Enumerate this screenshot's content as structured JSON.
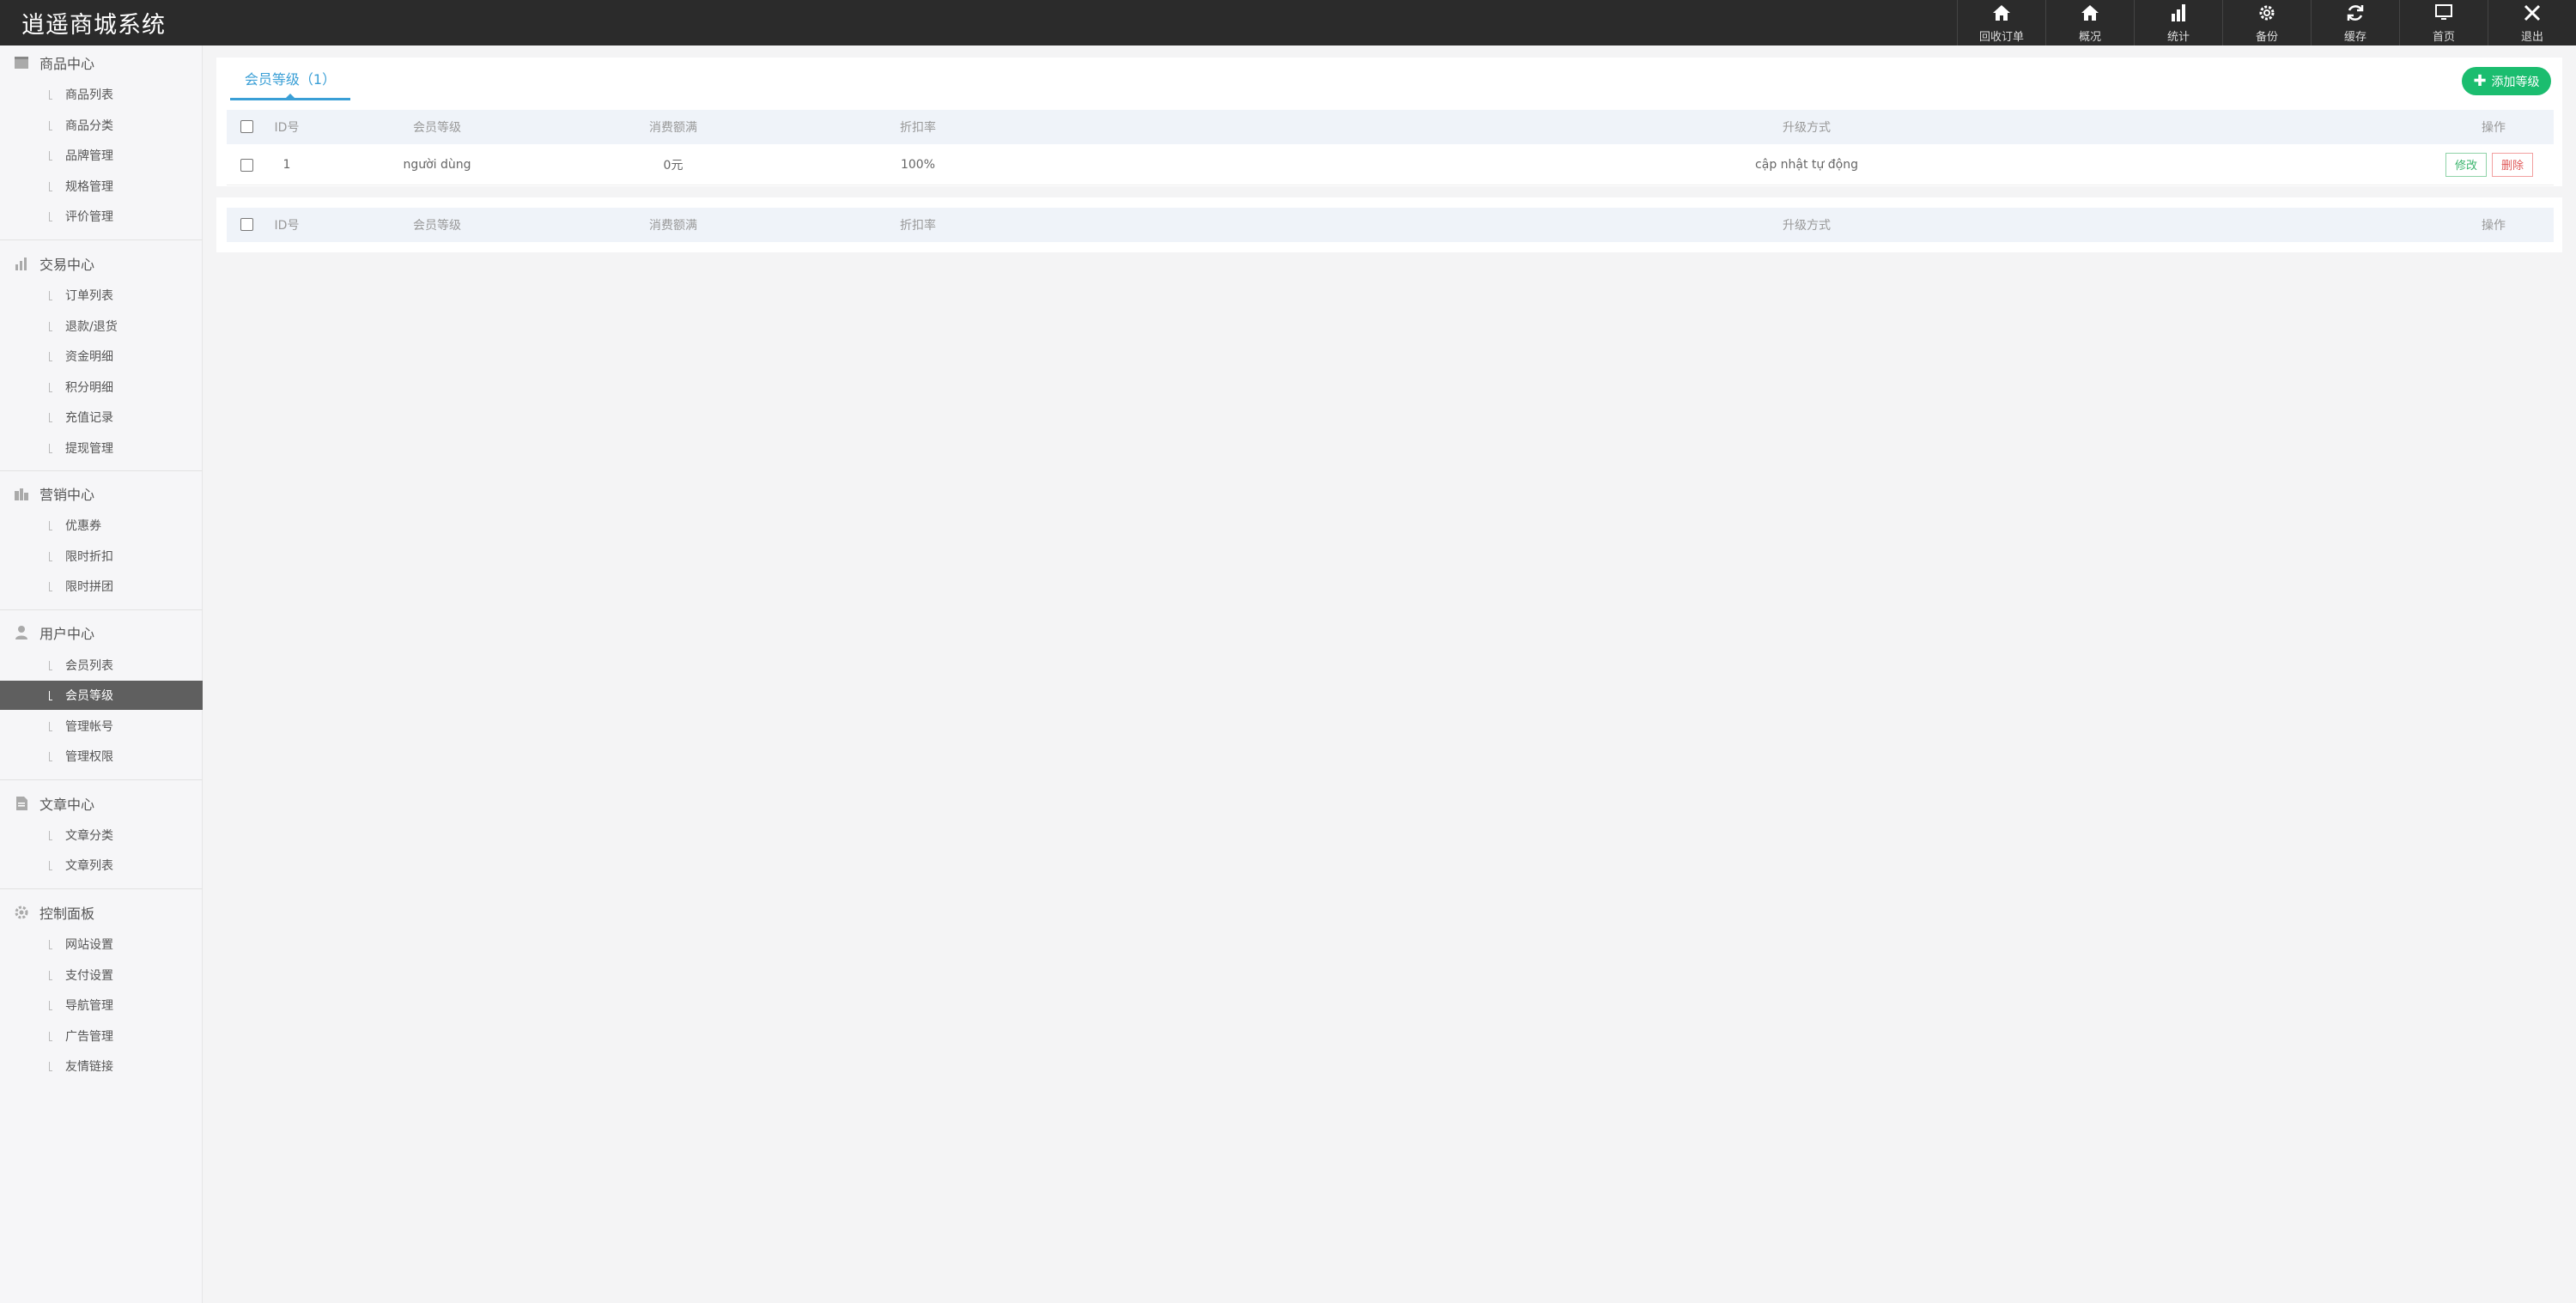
{
  "app": {
    "title": "逍遥商城系统"
  },
  "topnav": [
    {
      "label": "回收订单",
      "icon": "home-icon"
    },
    {
      "label": "概况",
      "icon": "home-icon"
    },
    {
      "label": "统计",
      "icon": "bar-chart-icon"
    },
    {
      "label": "备份",
      "icon": "gear-icon"
    },
    {
      "label": "缓存",
      "icon": "refresh-icon"
    },
    {
      "label": "首页",
      "icon": "monitor-icon"
    },
    {
      "label": "退出",
      "icon": "close-icon"
    }
  ],
  "sidebar": {
    "sections": [
      {
        "title": "商品中心",
        "icon": "box-icon",
        "items": [
          "商品列表",
          "商品分类",
          "品牌管理",
          "规格管理",
          "评价管理"
        ]
      },
      {
        "title": "交易中心",
        "icon": "bar-chart-icon",
        "items": [
          "订单列表",
          "退款/退货",
          "资金明细",
          "积分明细",
          "充值记录",
          "提现管理"
        ]
      },
      {
        "title": "营销中心",
        "icon": "marketing-icon",
        "items": [
          "优惠券",
          "限时折扣",
          "限时拼团"
        ]
      },
      {
        "title": "用户中心",
        "icon": "user-icon",
        "items": [
          "会员列表",
          "会员等级",
          "管理帐号",
          "管理权限"
        ]
      },
      {
        "title": "文章中心",
        "icon": "document-icon",
        "items": [
          "文章分类",
          "文章列表"
        ]
      },
      {
        "title": "控制面板",
        "icon": "gear-icon",
        "items": [
          "网站设置",
          "支付设置",
          "导航管理",
          "广告管理",
          "友情链接"
        ]
      }
    ],
    "active_item": "会员等级"
  },
  "main": {
    "tab_label": "会员等级（1）",
    "add_button": "添加等级",
    "columns": [
      "ID号",
      "会员等级",
      "消费额满",
      "折扣率",
      "升级方式",
      "操作"
    ],
    "rows": [
      {
        "id": "1",
        "level": "người dùng",
        "amount": "0元",
        "discount": "100%",
        "method": "cập nhật tự động",
        "edit": "修改",
        "delete": "删除"
      }
    ]
  },
  "colors": {
    "accent": "#3a9fd6",
    "add_button": "#1bbd6f",
    "topbar": "#2b2b2b",
    "active_item": "#5f5f5f"
  }
}
